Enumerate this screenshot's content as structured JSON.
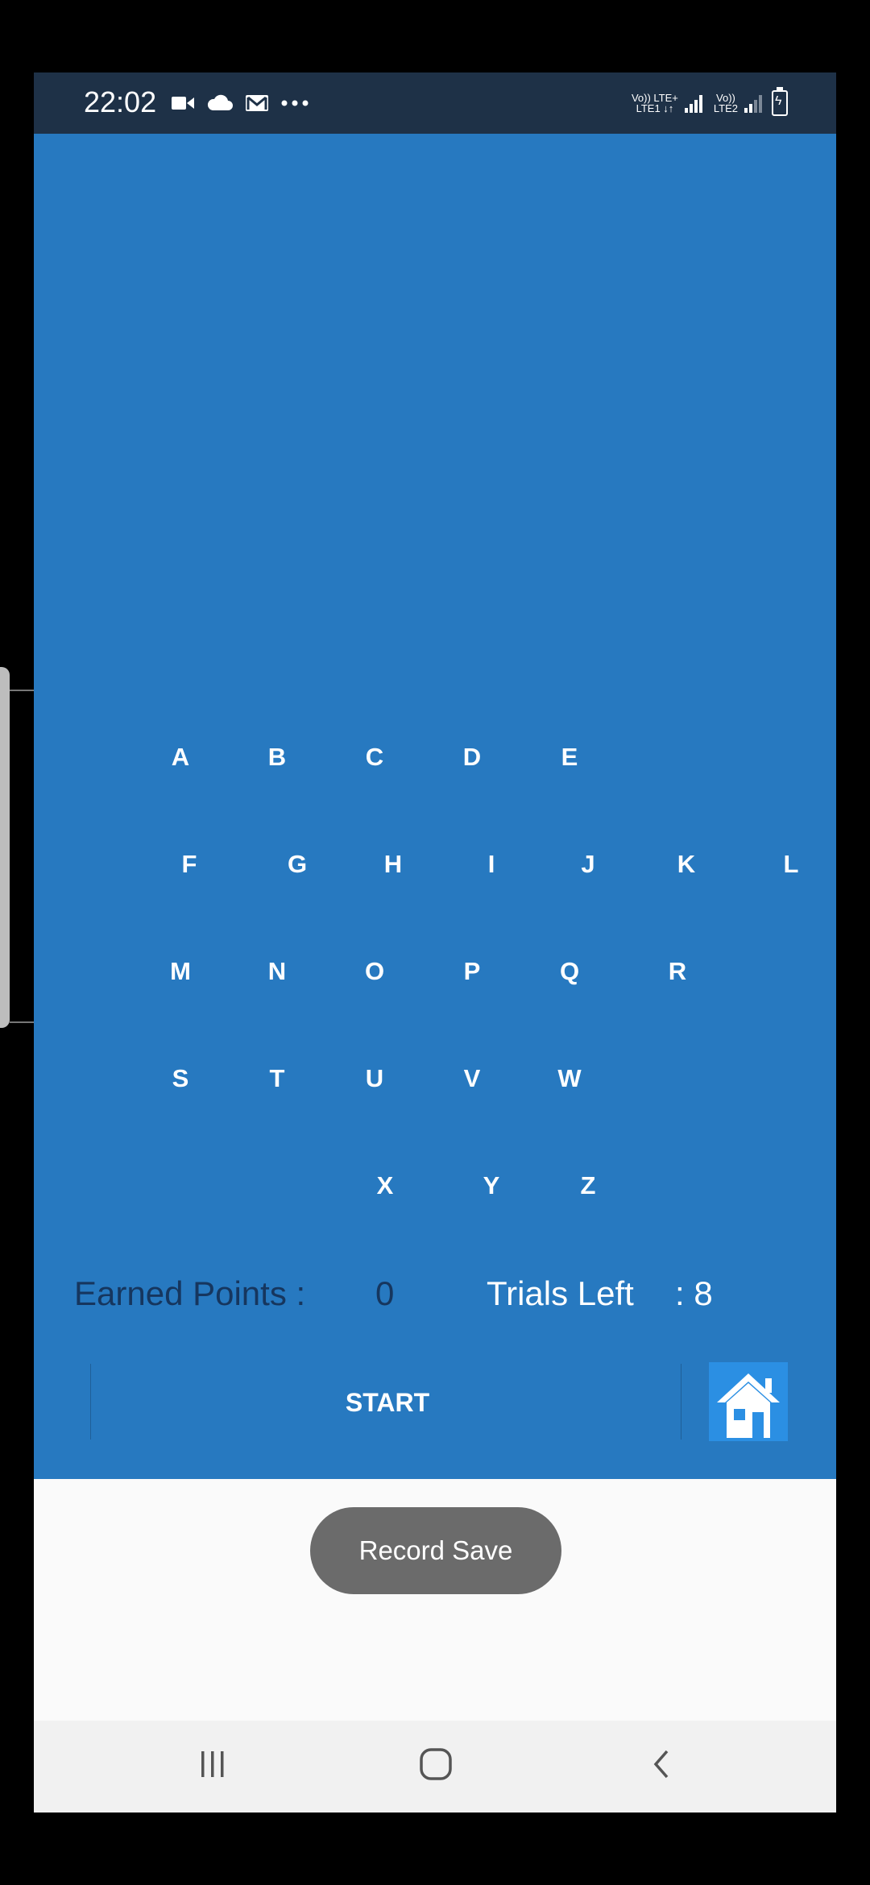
{
  "status_bar": {
    "time": "22:02",
    "icons": [
      "video-camera-icon",
      "cloud-icon",
      "gmail-icon",
      "more-dots-icon"
    ],
    "net1_top": "Vo)) LTE+",
    "net1_bottom": "LTE1 ↓↑",
    "net2_top": "Vo))",
    "net2_bottom": "LTE2"
  },
  "game": {
    "background_color": "#2779c0",
    "letters": [
      "A",
      "B",
      "C",
      "D",
      "E",
      "F",
      "G",
      "H",
      "I",
      "J",
      "K",
      "L",
      "M",
      "N",
      "O",
      "P",
      "Q",
      "R",
      "S",
      "T",
      "U",
      "V",
      "W",
      "X",
      "Y",
      "Z"
    ],
    "earned_points_label": "Earned Points :",
    "earned_points_value": "0",
    "trials_left_label": "Trials Left",
    "trials_left_value": ": 8",
    "start_label": "START",
    "home_icon": "home-icon"
  },
  "toast": {
    "message": "Record Save"
  },
  "nav_bar": {
    "items": [
      "recent-apps-icon",
      "home-circle-icon",
      "back-icon"
    ]
  }
}
